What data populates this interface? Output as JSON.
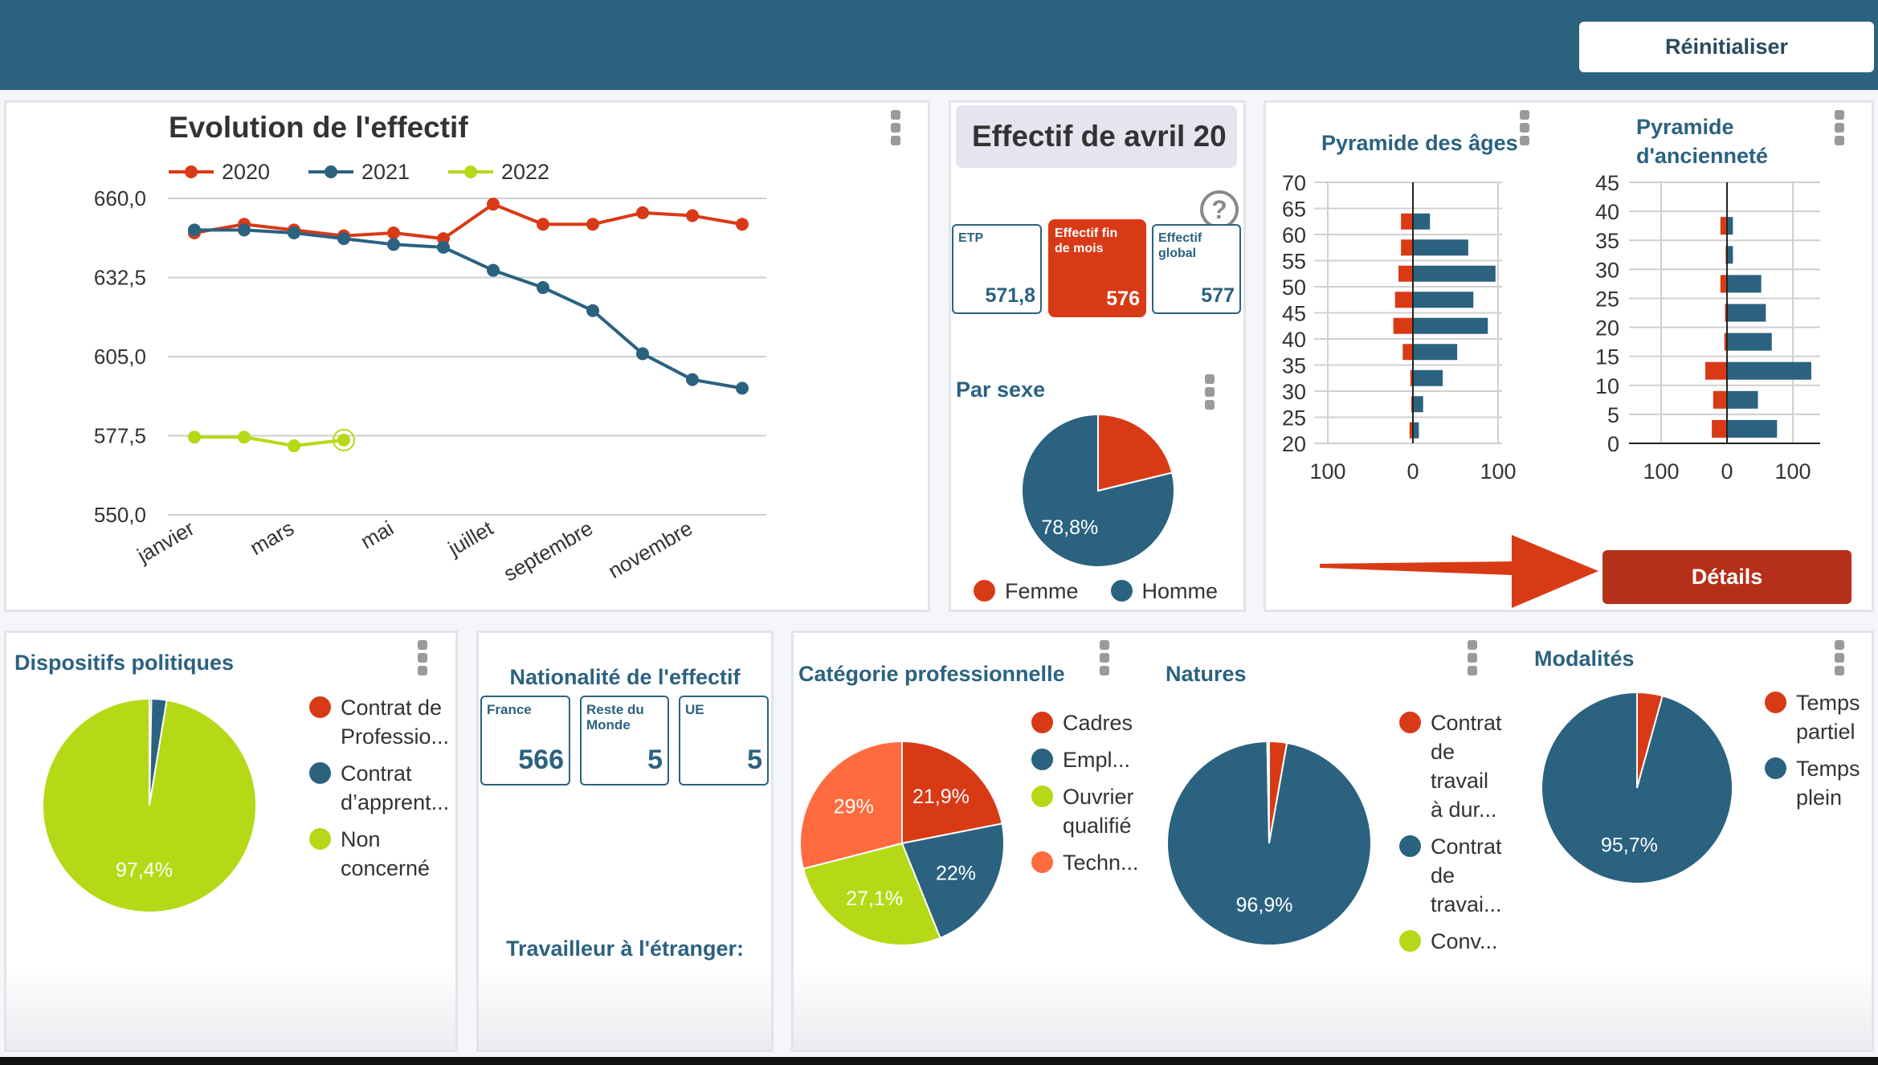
{
  "header": {
    "reset_label": "Réinitialiser"
  },
  "colors": {
    "red": "#d93a16",
    "blue": "#2b6280",
    "green": "#b5d916",
    "orange": "#ff6b3f"
  },
  "effectif": {
    "title": "Effectif de avril 20",
    "help_icon": "question-circle-icon",
    "kpis": [
      {
        "label": "ETP",
        "value": "571,8",
        "active": false
      },
      {
        "label": "Effectif fin de mois",
        "value": "576",
        "active": true
      },
      {
        "label": "Effectif global",
        "value": "577",
        "active": false
      }
    ]
  },
  "nationalite": {
    "title": "Nationalité de l'effectif",
    "kpis": [
      {
        "label": "France",
        "value": "566"
      },
      {
        "label": "Reste du Monde",
        "value": "5"
      },
      {
        "label": "UE",
        "value": "5"
      }
    ],
    "travailleur_title": "Travailleur à l'étranger:"
  },
  "details_label": "Détails",
  "chart_data": [
    {
      "id": "evolution",
      "type": "line",
      "title": "Evolution de l'effectif",
      "x": [
        1,
        2,
        3,
        4,
        5,
        6,
        7,
        8,
        9,
        10,
        11,
        12
      ],
      "xticks": {
        "positions": [
          1,
          3,
          5,
          7,
          9,
          11
        ],
        "labels": [
          "janvier",
          "mars",
          "mai",
          "juillet",
          "septembre",
          "novembre"
        ]
      },
      "yticks": {
        "values": [
          660,
          632.5,
          605,
          577.5,
          550
        ],
        "labels": [
          "660,0",
          "632,5",
          "605,0",
          "577,5",
          "550,0"
        ]
      },
      "ylim": [
        550,
        660
      ],
      "grid": true,
      "legend": "top-left",
      "series": [
        {
          "name": "2020",
          "color": "#d93a16",
          "values": [
            648,
            651,
            649,
            647,
            648,
            646,
            658,
            651,
            651,
            655,
            654,
            651
          ]
        },
        {
          "name": "2021",
          "color": "#2b6280",
          "values": [
            649,
            649,
            648,
            646,
            644,
            643,
            635,
            629,
            621,
            606,
            597,
            594
          ]
        },
        {
          "name": "2022",
          "color": "#b5d916",
          "values": [
            577,
            577,
            574,
            576
          ],
          "highlight_last": true
        }
      ]
    },
    {
      "id": "sexe",
      "type": "pie",
      "title": "Par sexe",
      "slices": [
        {
          "name": "Femme",
          "value": 21.2,
          "color": "#d93a16",
          "label": ""
        },
        {
          "name": "Homme",
          "value": 78.8,
          "color": "#2b6280",
          "label": "78,8%"
        }
      ],
      "legend": "bottom"
    },
    {
      "id": "ages",
      "type": "bar",
      "orientation": "horizontal",
      "title": "Pyramide des âges",
      "y": [
        22.5,
        27.5,
        32.5,
        37.5,
        42.5,
        47.5,
        52.5,
        57.5,
        62.5
      ],
      "series": [
        {
          "color": "#d93a16",
          "values": [
            -4,
            -2,
            -3,
            -12,
            -23,
            -21,
            -17,
            -14,
            -14
          ]
        },
        {
          "color": "#2b6280",
          "values": [
            7,
            12,
            35,
            52,
            88,
            71,
            97,
            65,
            20
          ]
        }
      ],
      "yticks": [
        20,
        25,
        30,
        35,
        40,
        45,
        50,
        55,
        60,
        65,
        70
      ],
      "xticks": {
        "values": [
          -100,
          0,
          100
        ],
        "labels": [
          "100",
          "0",
          "100"
        ]
      },
      "ylim": [
        20,
        70
      ],
      "xlim": [
        -100,
        100
      ],
      "grid": true
    },
    {
      "id": "anciennete",
      "type": "bar",
      "orientation": "horizontal",
      "title": "Pyramide d'ancienneté",
      "y": [
        2.5,
        7.5,
        12.5,
        17.5,
        22.5,
        27.5,
        32.5,
        37.5
      ],
      "series": [
        {
          "color": "#d93a16",
          "values": [
            -23,
            -21,
            -33,
            -4,
            -3,
            -10,
            -2,
            -10
          ]
        },
        {
          "color": "#2b6280",
          "values": [
            76,
            47,
            128,
            68,
            59,
            52,
            9,
            9
          ]
        }
      ],
      "yticks": [
        0,
        5,
        10,
        15,
        20,
        25,
        30,
        35,
        40,
        45
      ],
      "xticks": {
        "values": [
          -100,
          0,
          100
        ],
        "labels": [
          "100",
          "0",
          "100"
        ]
      },
      "ylim": [
        0,
        45
      ],
      "xlim": [
        -100,
        100
      ],
      "grid": true
    },
    {
      "id": "dispositifs",
      "type": "pie",
      "title": "Dispositifs politiques",
      "slices": [
        {
          "name": "Contrat de Professio...",
          "value": 0.3,
          "color": "#d93a16",
          "label": ""
        },
        {
          "name": "Contrat d’apprent...",
          "value": 2.3,
          "color": "#2b6280",
          "label": ""
        },
        {
          "name": "Non concerné",
          "value": 97.4,
          "color": "#b5d916",
          "label": "97,4%"
        }
      ],
      "legend": "right"
    },
    {
      "id": "categorie",
      "type": "pie",
      "title": "Catégorie professionnelle",
      "slices": [
        {
          "name": "Cadres",
          "value": 21.9,
          "color": "#d93a16",
          "label": "21,9%"
        },
        {
          "name": "Empl...",
          "value": 22,
          "color": "#2b6280",
          "label": "22%"
        },
        {
          "name": "Ouvrier qualifié",
          "value": 27.1,
          "color": "#b5d916",
          "label": "27,1%"
        },
        {
          "name": "Techn...",
          "value": 29,
          "color": "#ff6b3f",
          "label": "29%"
        }
      ],
      "legend": "right"
    },
    {
      "id": "natures",
      "type": "pie",
      "title": "Natures",
      "slices": [
        {
          "name": "Contrat de travail à dur...",
          "value": 2.8,
          "color": "#d93a16",
          "label": ""
        },
        {
          "name": "Contrat de travai...",
          "value": 96.9,
          "color": "#2b6280",
          "label": "96,9%"
        },
        {
          "name": "Conv...",
          "value": 0.3,
          "color": "#b5d916",
          "label": ""
        }
      ],
      "legend": "right"
    },
    {
      "id": "modalites",
      "type": "pie",
      "title": "Modalités",
      "slices": [
        {
          "name": "Temps partiel",
          "value": 4.3,
          "color": "#d93a16",
          "label": ""
        },
        {
          "name": "Temps plein",
          "value": 95.7,
          "color": "#2b6280",
          "label": "95,7%"
        }
      ],
      "legend": "right"
    }
  ]
}
